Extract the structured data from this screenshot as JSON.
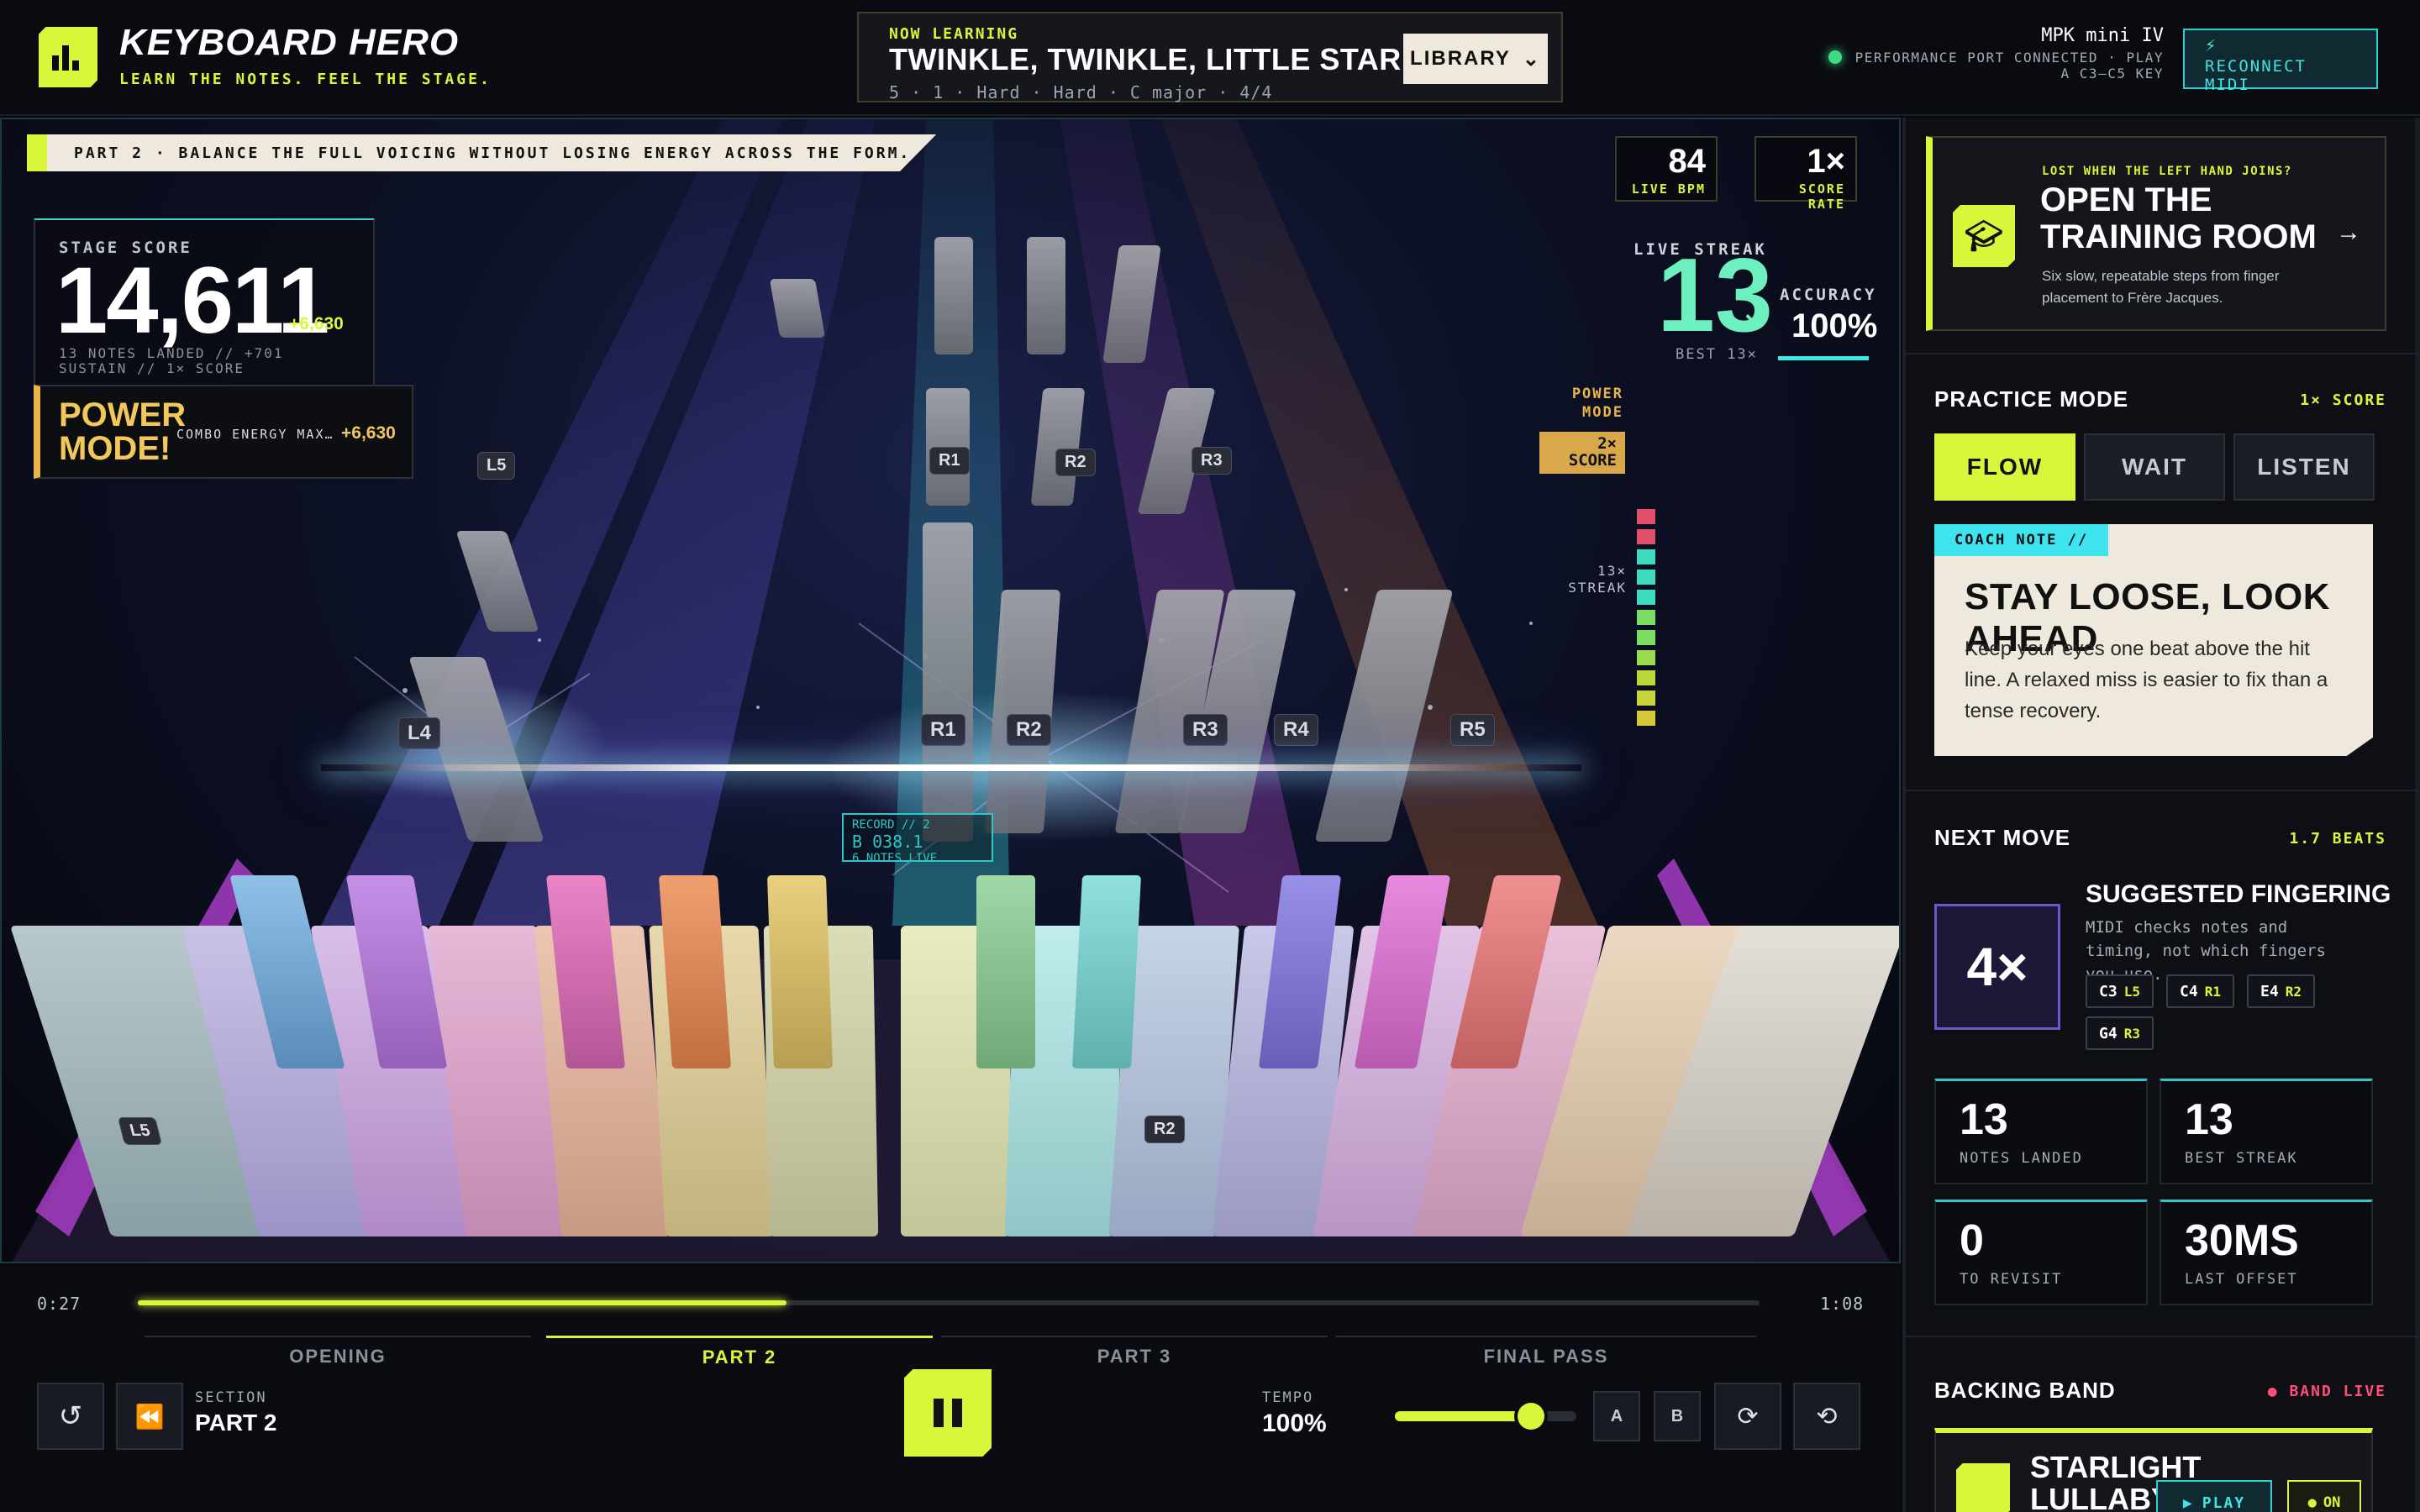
{
  "header": {
    "brand_title": "KEYBOARD HERO",
    "brand_subtitle": "LEARN THE NOTES. FEEL THE STAGE.",
    "now_label": "NOW LEARNING",
    "song_title": "TWINKLE, TWINKLE, LITTLE STAR",
    "song_meta": "5 · 1 · Hard · Hard · C major · 4/4",
    "library_label": "LIBRARY",
    "device_name": "MPK mini IV",
    "device_status": "PERFORMANCE PORT CONNECTED · PLAY",
    "device_range": "A C3–C5 KEY",
    "reconnect_label": "RECONNECT MIDI"
  },
  "stage": {
    "section_banner": "PART 2 · BALANCE THE FULL VOICING WITHOUT LOSING ENERGY ACROSS THE FORM.",
    "score_label": "STAGE SCORE",
    "score_value": "14,611",
    "score_gain": "+6,630",
    "score_sub1": "13 NOTES LANDED // +701",
    "score_sub2": "SUSTAIN // 1× SCORE",
    "power_title_1": "POWER",
    "power_title_2": "MODE!",
    "power_combo": "COMBO ENERGY MAX…",
    "power_gain": "+6,630",
    "live_bpm_value": "84",
    "live_bpm_label": "LIVE BPM",
    "score_rate_value": "1×",
    "score_rate_label": "SCORE RATE",
    "streak_label": "LIVE STREAK",
    "streak_value": "13",
    "streak_x": "×",
    "streak_best": "BEST 13×",
    "accuracy_label": "ACCURACY",
    "accuracy_value": "100%",
    "power_meter_label_1": "POWER",
    "power_meter_label_2": "MODE",
    "power_meter_badge_1": "2×",
    "power_meter_badge_2": "SCORE",
    "power_meter_streak_1": "13×",
    "power_meter_streak_2": "STREAK",
    "hud_line1": "RECORD // 2",
    "hud_line2": "B 038.1",
    "hud_line3": "6 NOTES LIVE",
    "finger_tags": [
      "L5",
      "R1",
      "R2",
      "R3",
      "L4",
      "R1",
      "R2",
      "R3",
      "R4",
      "R5",
      "L5",
      "R2"
    ]
  },
  "transport": {
    "time_current": "0:27",
    "time_total": "1:08",
    "progress": 0.4,
    "sections": [
      "OPENING",
      "PART 2",
      "PART 3",
      "FINAL PASS"
    ],
    "active_section": 1,
    "section_label": "SECTION",
    "section_value": "PART 2",
    "tempo_label": "TEMPO",
    "tempo_value": "100%",
    "tempo_level": 0.75,
    "loop_a": "A",
    "loop_b": "B"
  },
  "sidebar": {
    "training_kicker": "LOST WHEN THE LEFT HAND JOINS?",
    "training_title": "OPEN THE TRAINING ROOM",
    "training_desc": "Six slow, repeatable steps from finger placement to Frère Jacques.",
    "practice_title": "PRACTICE MODE",
    "practice_rate": "1× SCORE",
    "modes": [
      "FLOW",
      "WAIT",
      "LISTEN"
    ],
    "active_mode": 0,
    "coach_tag": "COACH NOTE //",
    "coach_title": "STAY LOOSE, LOOK AHEAD",
    "coach_body": "Keep your eyes one beat above the hit line. A relaxed miss is easier to fix than a tense recovery.",
    "next_title": "NEXT MOVE",
    "next_beats": "1.7 BEATS",
    "finger_badge": "4×",
    "fingering_title": "SUGGESTED FINGERING",
    "fingering_desc": "MIDI checks notes and timing, not which fingers you use.",
    "chips": [
      {
        "note": "C3",
        "finger": "L5"
      },
      {
        "note": "C4",
        "finger": "R1"
      },
      {
        "note": "E4",
        "finger": "R2"
      },
      {
        "note": "G4",
        "finger": "R3"
      }
    ],
    "stats": [
      {
        "value": "13",
        "label": "NOTES LANDED"
      },
      {
        "value": "13",
        "label": "BEST STREAK"
      },
      {
        "value": "0",
        "label": "TO REVISIT"
      },
      {
        "value": "30MS",
        "label": "LAST OFFSET"
      }
    ],
    "band_title": "BACKING BAND",
    "band_status": "● BAND LIVE",
    "band_song": "STARLIGHT LULLABY",
    "band_play": "PLAY",
    "band_on": "ON"
  },
  "colors": {
    "accent": "#d9f63a",
    "cyan": "#3de4ee",
    "streak": "#6cf0c0",
    "power": "#e8b64a"
  }
}
